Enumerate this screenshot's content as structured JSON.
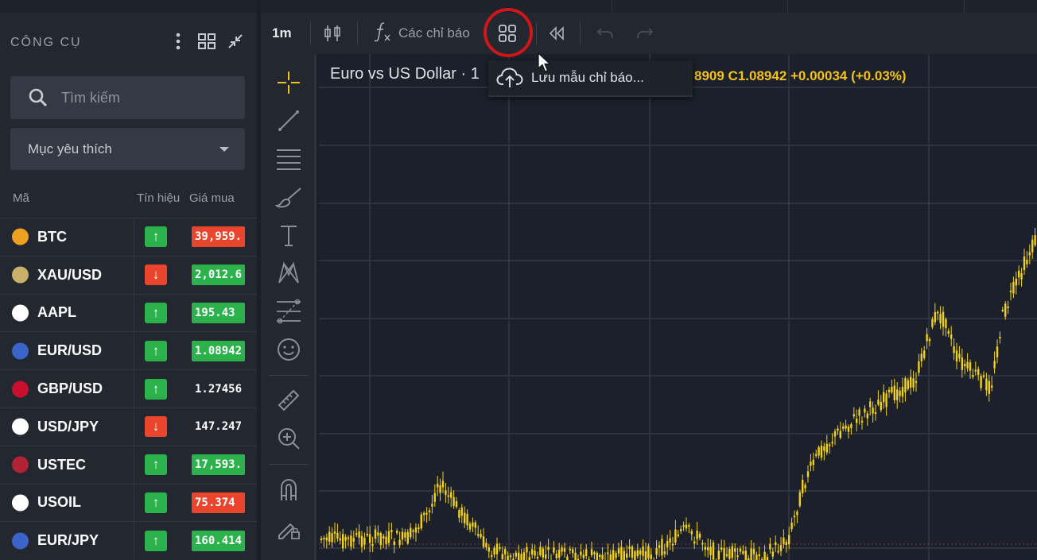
{
  "left_panel": {
    "title": "CÔNG CỤ",
    "search_placeholder": "Tìm kiếm",
    "list_dropdown": "Mục yêu thích",
    "columns": {
      "symbol": "Mã",
      "signal": "Tín hiệu",
      "bid": "Giá mua"
    },
    "instruments": [
      {
        "symbol": "BTC",
        "signal": "up",
        "price": "39,959.",
        "price_bg": "#e8452c",
        "icon_color": "#f0a020"
      },
      {
        "symbol": "XAU/USD",
        "signal": "down",
        "price": "2,012.6",
        "price_bg": "#2bb24c",
        "icon_color": "#c9b16a"
      },
      {
        "symbol": "AAPL",
        "signal": "up",
        "price": "195.43",
        "price_bg": "#2bb24c",
        "icon_color": "#ffffff"
      },
      {
        "symbol": "EUR/USD",
        "signal": "up",
        "price": "1.08942",
        "price_bg": "#2bb24c",
        "icon_color": "#3a64c8"
      },
      {
        "symbol": "GBP/USD",
        "signal": "up",
        "price": "1.27456",
        "price_bg": "transparent",
        "icon_color": "#c8102e"
      },
      {
        "symbol": "USD/JPY",
        "signal": "down",
        "price": "147.247",
        "price_bg": "transparent",
        "icon_color": "#ffffff"
      },
      {
        "symbol": "USTEC",
        "signal": "up",
        "price": "17,593.",
        "price_bg": "#2bb24c",
        "icon_color": "#b22234"
      },
      {
        "symbol": "USOIL",
        "signal": "up",
        "price": "75.374",
        "price_bg": "#e8452c",
        "icon_color": "#ffffff"
      },
      {
        "symbol": "EUR/JPY",
        "signal": "up",
        "price": "160.414",
        "price_bg": "#2bb24c",
        "icon_color": "#3a64c8"
      }
    ]
  },
  "toolbar": {
    "interval": "1m",
    "indicators_label": "Các chỉ báo"
  },
  "chart": {
    "title": "Euro vs US Dollar · 1",
    "ohlc_text": "8909  C1.08942  +0.00034 (+0.03%)"
  },
  "popup": {
    "save_template_label": "Lưu mẫu chỉ báo..."
  },
  "colors": {
    "up": "#2bb24c",
    "down": "#e8452c",
    "candle": "#f2d21b",
    "highlight_circle": "#d0161a"
  }
}
